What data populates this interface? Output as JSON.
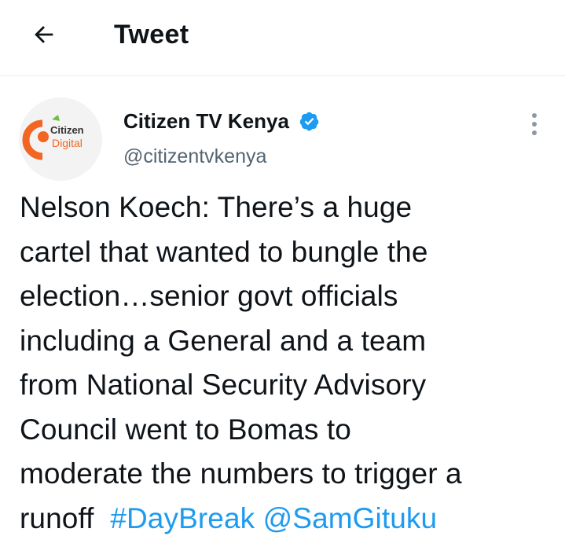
{
  "header": {
    "back_icon": "arrow-left-icon",
    "title": "Tweet"
  },
  "author": {
    "avatar_icon": "citizen-digital-logo",
    "avatar_text_1": "Citizen",
    "avatar_text_2": "Digital",
    "display_name": "Citizen TV Kenya",
    "verified_icon": "verified-badge-icon",
    "handle": "@citizentvkenya",
    "more_icon": "more-vertical-icon"
  },
  "tweet": {
    "lines": [
      "Nelson Koech: There’s a huge",
      "cartel that wanted to bungle the",
      "election…senior govt officials",
      "including a General and a team",
      "from National Security Advisory",
      "Council went to Bomas to",
      "moderate the numbers to trigger a"
    ],
    "last_line_text": "runoff",
    "hashtag": "#DayBreak",
    "mention": "@SamGituku"
  },
  "colors": {
    "link": "#1d9bf0",
    "secondary_text": "#536471",
    "logo_orange": "#f26522",
    "logo_green": "#6abf4b"
  }
}
